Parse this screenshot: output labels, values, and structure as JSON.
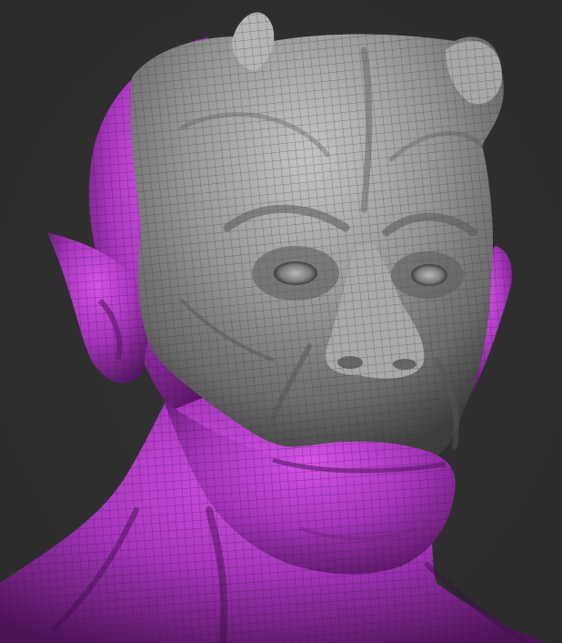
{
  "scene": {
    "subject": "sculpted-demon-head-bust",
    "background_color": "#2e2e2e",
    "sculpt_base_color": "#8e8e8e",
    "mask_color": "#b03ac4",
    "wireframe": true,
    "masked_regions": [
      "head-back-left",
      "left-ear",
      "right-ear",
      "mouth-and-chin",
      "neck-and-shoulders"
    ]
  }
}
